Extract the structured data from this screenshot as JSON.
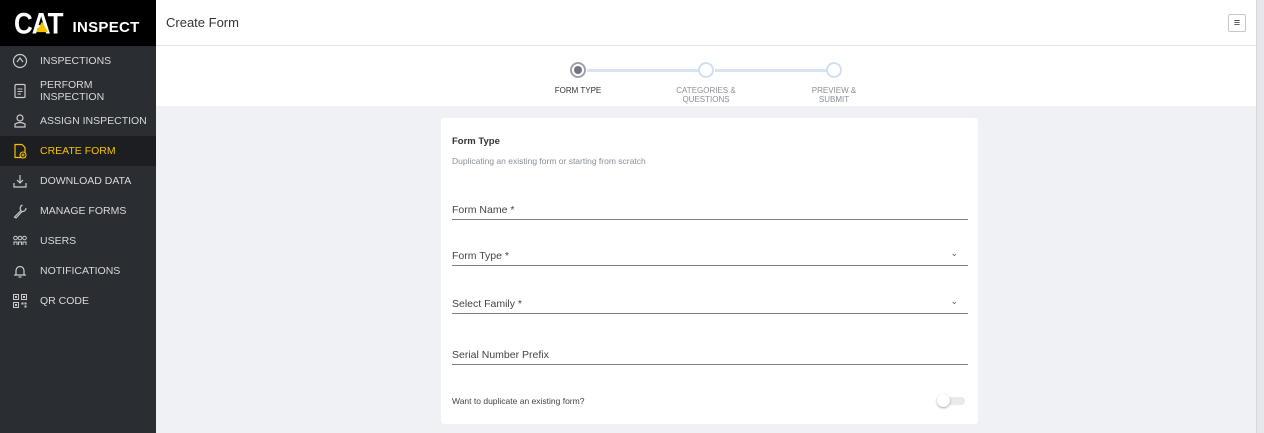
{
  "brand": {
    "logo_text": "CAT",
    "product": "INSPECT",
    "accent_color": "#f5c200"
  },
  "header": {
    "title": "Create Form",
    "menu_icon": "hamburger-icon"
  },
  "sidebar": {
    "items": [
      {
        "label": "INSPECTIONS",
        "icon": "inspections-icon",
        "active": false
      },
      {
        "label": "PERFORM INSPECTION",
        "icon": "document-icon",
        "active": false
      },
      {
        "label": "ASSIGN INSPECTION",
        "icon": "assign-user-icon",
        "active": false
      },
      {
        "label": "CREATE FORM",
        "icon": "create-form-icon",
        "active": true
      },
      {
        "label": "DOWNLOAD DATA",
        "icon": "download-icon",
        "active": false
      },
      {
        "label": "MANAGE FORMS",
        "icon": "wrench-icon",
        "active": false
      },
      {
        "label": "USERS",
        "icon": "users-icon",
        "active": false
      },
      {
        "label": "NOTIFICATIONS",
        "icon": "bell-icon",
        "active": false
      },
      {
        "label": "QR CODE",
        "icon": "qr-code-icon",
        "active": false
      }
    ]
  },
  "stepper": {
    "steps": [
      {
        "label": "FORM TYPE",
        "active": true
      },
      {
        "label": "CATEGORIES & QUESTIONS",
        "active": false
      },
      {
        "label": "PREVIEW & SUBMIT",
        "active": false
      }
    ]
  },
  "form": {
    "title": "Form Type",
    "subtitle": "Duplicating an existing form or starting from scratch",
    "fields": {
      "form_name": {
        "label": "Form Name *",
        "value": ""
      },
      "form_type": {
        "label": "Form Type *",
        "value": ""
      },
      "select_family": {
        "label": "Select Family *",
        "value": ""
      },
      "serial_prefix": {
        "label": "Serial Number Prefix",
        "value": ""
      }
    },
    "duplicate_toggle": {
      "label": "Want to duplicate an existing form?",
      "on": false
    }
  }
}
